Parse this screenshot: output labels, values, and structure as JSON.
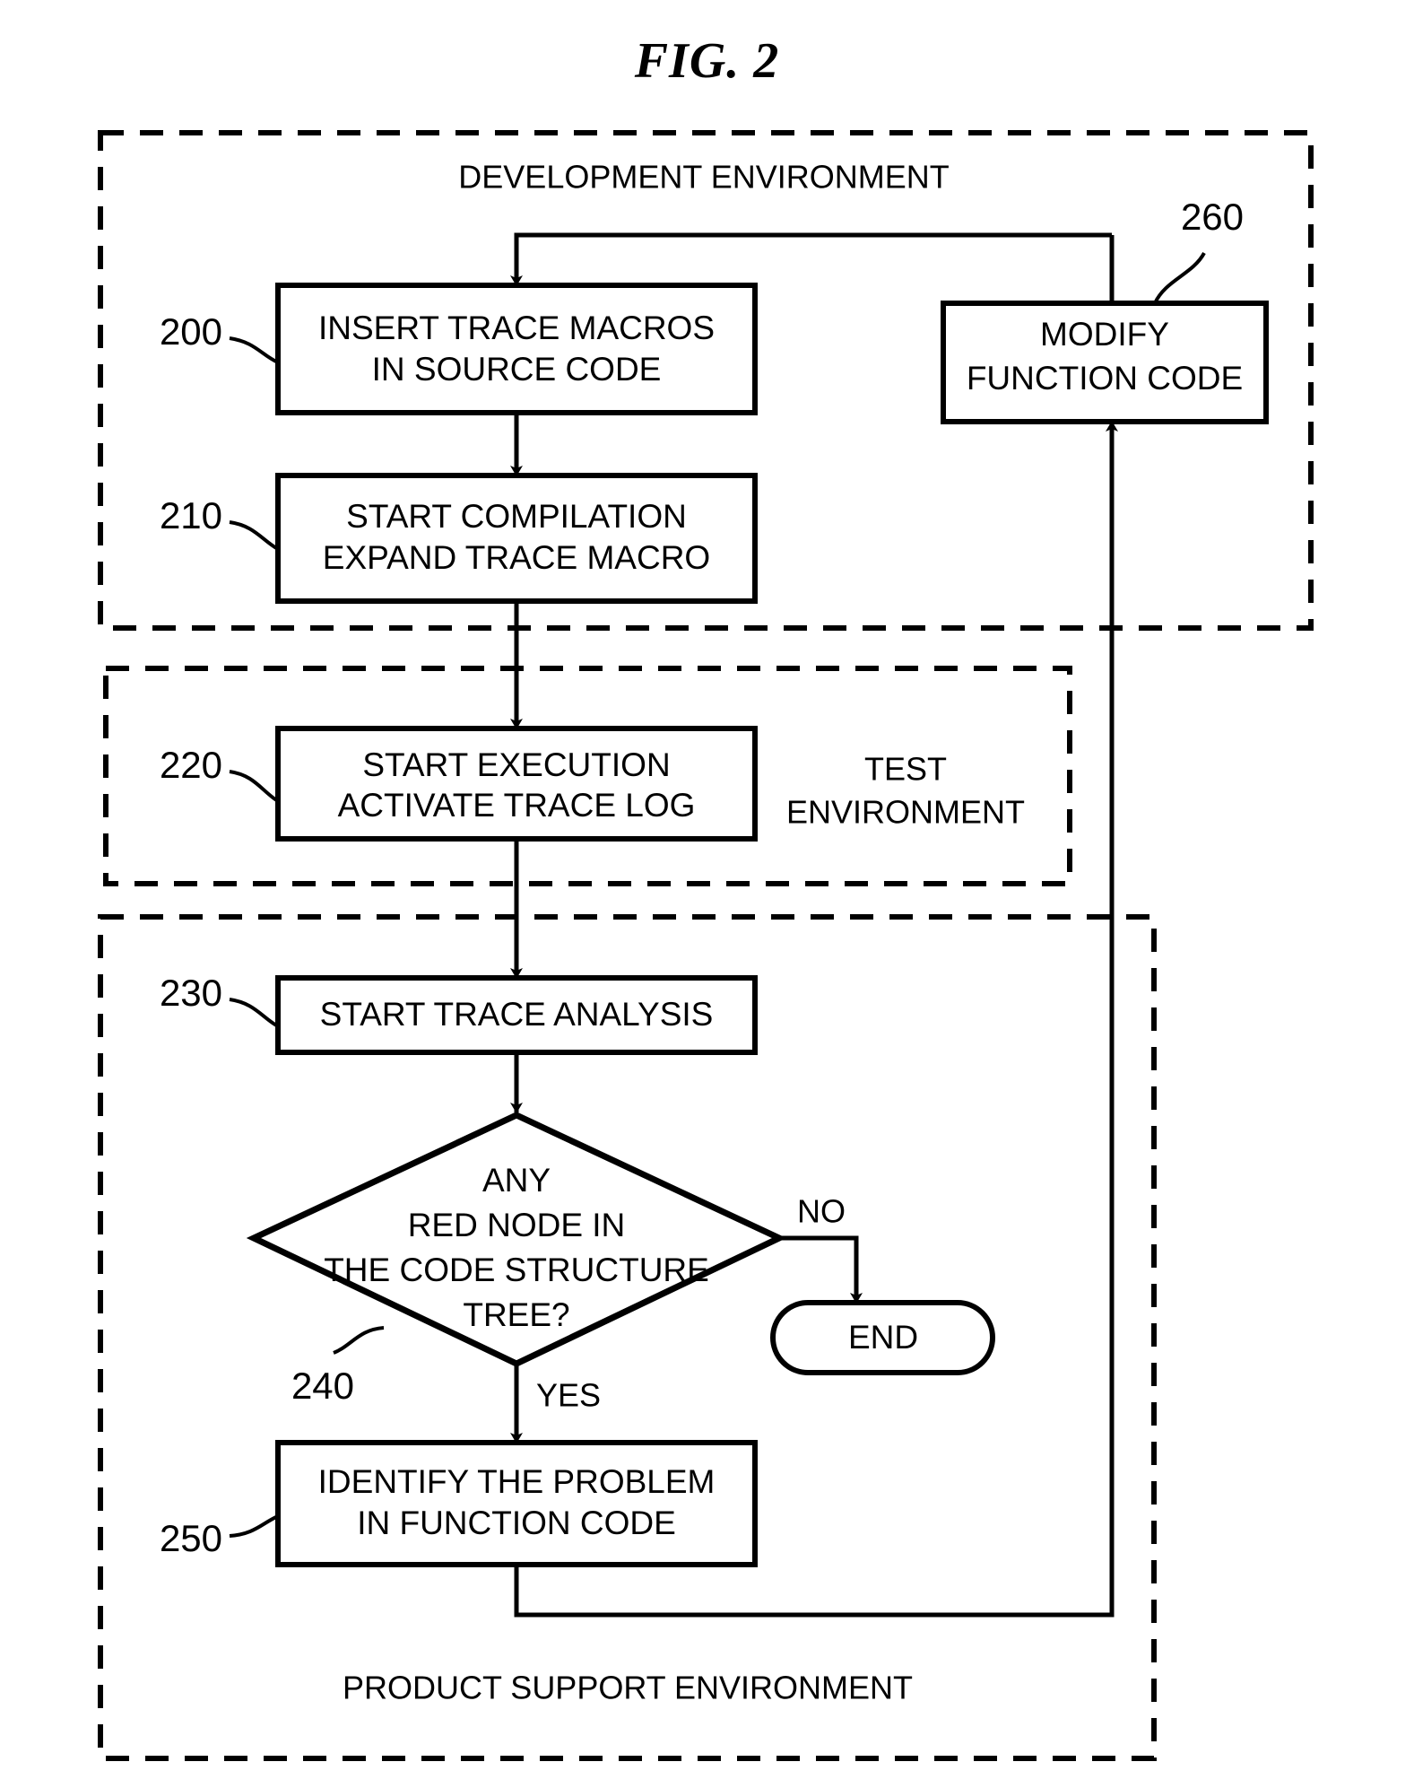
{
  "figure": {
    "title": "FIG. 2"
  },
  "environments": [
    {
      "id": "development",
      "label": "DEVELOPMENT ENVIRONMENT"
    },
    {
      "id": "test",
      "label_line1": "TEST",
      "label_line2": "ENVIRONMENT"
    },
    {
      "id": "product_support",
      "label": "PRODUCT SUPPORT ENVIRONMENT"
    }
  ],
  "nodes": [
    {
      "ref": "200",
      "shape": "process",
      "line1": "INSERT TRACE MACROS",
      "line2": "IN SOURCE CODE"
    },
    {
      "ref": "210",
      "shape": "process",
      "line1": "START COMPILATION",
      "line2": "EXPAND TRACE MACRO"
    },
    {
      "ref": "220",
      "shape": "process",
      "line1": "START EXECUTION",
      "line2": "ACTIVATE TRACE LOG"
    },
    {
      "ref": "230",
      "shape": "process",
      "line1": "START TRACE ANALYSIS"
    },
    {
      "ref": "240",
      "shape": "decision",
      "line1": "ANY",
      "line2": "RED NODE IN",
      "line3": "THE CODE STRUCTURE",
      "line4": "TREE?"
    },
    {
      "ref": "250",
      "shape": "process",
      "line1": "IDENTIFY THE PROBLEM",
      "line2": "IN FUNCTION CODE"
    },
    {
      "ref": "260",
      "shape": "process",
      "line1": "MODIFY",
      "line2": "FUNCTION CODE"
    },
    {
      "ref": "",
      "shape": "terminator",
      "line1": "END"
    }
  ],
  "branches": {
    "no": "NO",
    "yes": "YES"
  },
  "colors": {
    "ink": "#000000",
    "paper": "#ffffff"
  }
}
